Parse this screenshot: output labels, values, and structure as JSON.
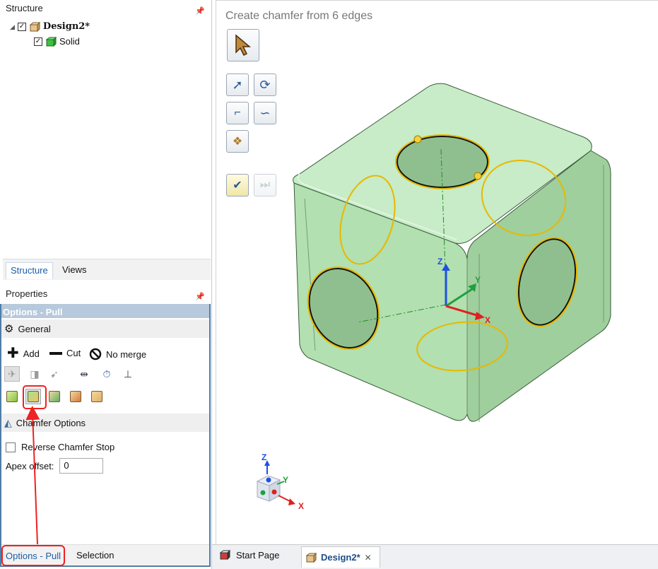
{
  "structure_panel": {
    "title": "Structure",
    "tree": [
      {
        "label": "Design2*",
        "checked": true,
        "icon": "design-icon"
      },
      {
        "label": "Solid",
        "checked": true,
        "icon": "solid-body-icon"
      }
    ],
    "tabs": [
      {
        "label": "Structure",
        "active": true
      },
      {
        "label": "Views",
        "active": false
      }
    ]
  },
  "properties_panel": {
    "title": "Properties",
    "options_header": "Options - Pull",
    "general": {
      "title": "General",
      "modes": [
        {
          "label": "Add",
          "icon": "plus-icon"
        },
        {
          "label": "Cut",
          "icon": "minus-icon"
        },
        {
          "label": "No merge",
          "icon": "no-icon"
        }
      ]
    },
    "chamfer_options": {
      "title": "Chamfer Options",
      "reverse_chamfer_stop": {
        "label": "Reverse Chamfer Stop",
        "checked": false
      },
      "apex_offset": {
        "label": "Apex offset:",
        "value": "0"
      }
    },
    "bottom_tabs": [
      {
        "label": "Options - Pull",
        "active": true
      },
      {
        "label": "Selection",
        "active": false
      }
    ]
  },
  "viewport": {
    "status_text": "Create chamfer from 6 edges",
    "axis_labels": {
      "z": "Z",
      "y": "Y",
      "x": "X"
    },
    "colors": {
      "body": "#b7e3b7",
      "edge_highlight": "#e8b800",
      "axis_x": "#e02020",
      "axis_y": "#20a040",
      "axis_z": "#2050e0"
    }
  },
  "doc_tabs": [
    {
      "label": "Start Page",
      "active": false
    },
    {
      "label": "Design2*",
      "active": true,
      "close": "✕"
    }
  ]
}
